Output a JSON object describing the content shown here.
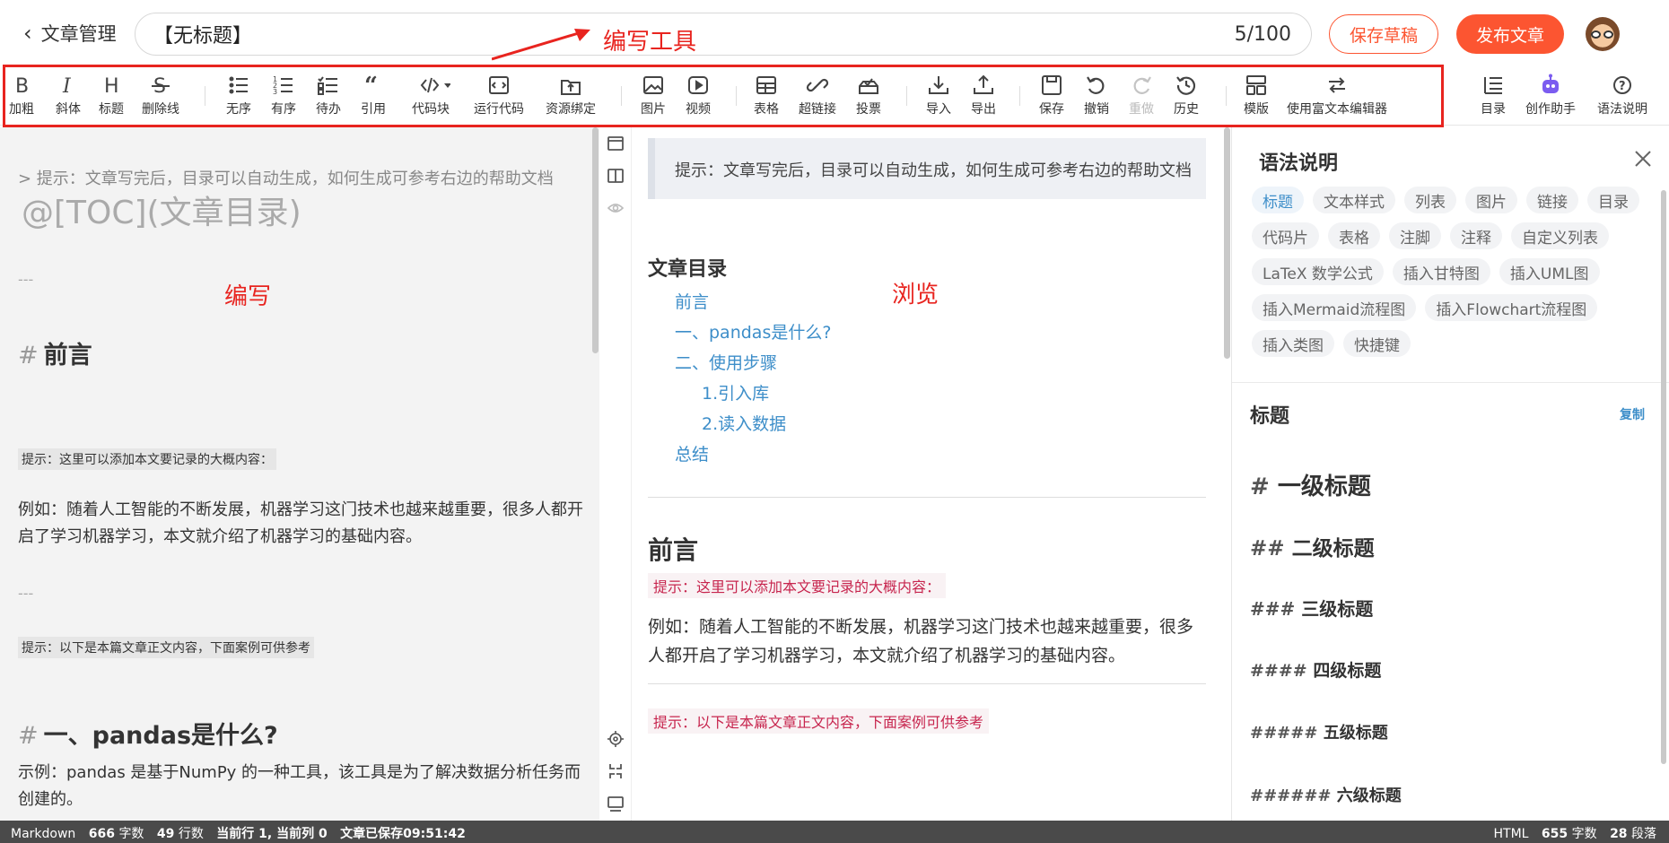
{
  "header": {
    "back_label": "文章管理",
    "title_value": "【无标题】",
    "title_count": "5/100",
    "save_draft": "保存草稿",
    "publish": "发布文章"
  },
  "annotations": {
    "toolbar": "编写工具",
    "editor": "编写",
    "preview": "浏览",
    "color": "#e8241f"
  },
  "toolbar": {
    "items": [
      {
        "label": "加粗",
        "icon": "bold-icon"
      },
      {
        "label": "斜体",
        "icon": "italic-icon"
      },
      {
        "label": "标题",
        "icon": "heading-icon"
      },
      {
        "label": "删除线",
        "icon": "strikethrough-icon"
      },
      {
        "label": "无序",
        "icon": "unordered-list-icon"
      },
      {
        "label": "有序",
        "icon": "ordered-list-icon"
      },
      {
        "label": "待办",
        "icon": "todo-list-icon"
      },
      {
        "label": "引用",
        "icon": "quote-icon"
      },
      {
        "label": "代码块",
        "icon": "code-block-icon"
      },
      {
        "label": "运行代码",
        "icon": "run-code-icon"
      },
      {
        "label": "资源绑定",
        "icon": "resource-upload-icon"
      },
      {
        "label": "图片",
        "icon": "image-icon"
      },
      {
        "label": "视频",
        "icon": "video-icon"
      },
      {
        "label": "表格",
        "icon": "table-icon"
      },
      {
        "label": "超链接",
        "icon": "link-icon"
      },
      {
        "label": "投票",
        "icon": "vote-icon"
      },
      {
        "label": "导入",
        "icon": "import-icon"
      },
      {
        "label": "导出",
        "icon": "export-icon"
      },
      {
        "label": "保存",
        "icon": "save-icon"
      },
      {
        "label": "撤销",
        "icon": "undo-icon"
      },
      {
        "label": "重做",
        "icon": "redo-icon",
        "disabled": true
      },
      {
        "label": "历史",
        "icon": "history-icon"
      },
      {
        "label": "模版",
        "icon": "template-icon"
      },
      {
        "label": "使用富文本编辑器",
        "icon": "switch-editor-icon"
      }
    ],
    "right_items": [
      {
        "label": "目录",
        "icon": "toc-icon"
      },
      {
        "label": "创作助手",
        "icon": "assistant-robot-icon"
      },
      {
        "label": "语法说明",
        "icon": "help-circle-icon"
      }
    ]
  },
  "editor": {
    "hint": "> 提示：文章写完后，目录可以自动生成，如何生成可参考右边的帮助文档",
    "toc": "@[TOC](文章目录)",
    "hr": "---",
    "h1_prefix": "#",
    "h1_intro": "前言",
    "tip_intro": "提示：这里可以添加本文要记录的大概内容：",
    "para_intro": "例如：随着人工智能的不断发展，机器学习这门技术也越来越重要，很多人都开启了学习机器学习，本文就介绍了机器学习的基础内容。",
    "tip_body": "提示：以下是本篇文章正文内容，下面案例可供参考",
    "h1_pandas": "一、pandas是什么?",
    "para_pandas": "示例：pandas 是基于NumPy 的一种工具，该工具是为了解决数据分析任务而创建的。"
  },
  "preview": {
    "blockquote": "提示：文章写完后，目录可以自动生成，如何生成可参考右边的帮助文档",
    "toc_title": "文章目录",
    "toc_items": [
      "前言",
      "一、pandas是什么?",
      "二、使用步骤",
      "1.引入库",
      "2.读入数据",
      "总结"
    ],
    "h2_intro": "前言",
    "tip_intro": "提示：这里可以添加本文要记录的大概内容：",
    "para_intro": "例如：随着人工智能的不断发展，机器学习这门技术也越来越重要，很多人都开启了学习机器学习，本文就介绍了机器学习的基础内容。",
    "tip_body": "提示：以下是本篇文章正文内容，下面案例可供参考"
  },
  "syntax": {
    "title": "语法说明",
    "tags": [
      "标题",
      "文本样式",
      "列表",
      "图片",
      "链接",
      "目录",
      "代码片",
      "表格",
      "注脚",
      "注释",
      "自定义列表",
      "LaTeX 数学公式",
      "插入甘特图",
      "插入UML图",
      "插入Mermaid流程图",
      "插入Flowchart流程图",
      "插入类图",
      "快捷键"
    ],
    "active_tag": "标题",
    "section_title": "标题",
    "copy": "复制",
    "headings": [
      {
        "hash": "#",
        "text": "一级标题"
      },
      {
        "hash": "##",
        "text": "二级标题"
      },
      {
        "hash": "###",
        "text": "三级标题"
      },
      {
        "hash": "####",
        "text": "四级标题"
      },
      {
        "hash": "#####",
        "text": "五级标题"
      },
      {
        "hash": "######",
        "text": "六级标题"
      }
    ]
  },
  "status": {
    "mode": "Markdown",
    "words": "666",
    "words_unit": "字数",
    "lines": "49",
    "lines_unit": "行数",
    "cursor_label": "当前行 1, 当前列 0",
    "saved": "文章已保存09:51:42",
    "right_mode": "HTML",
    "right_words": "655",
    "right_words_unit": "字数",
    "right_paras": "28",
    "right_paras_unit": "段落"
  },
  "colors": {
    "accent": "#fc5531",
    "link": "#3d8ec9",
    "code": "#c7254e"
  }
}
